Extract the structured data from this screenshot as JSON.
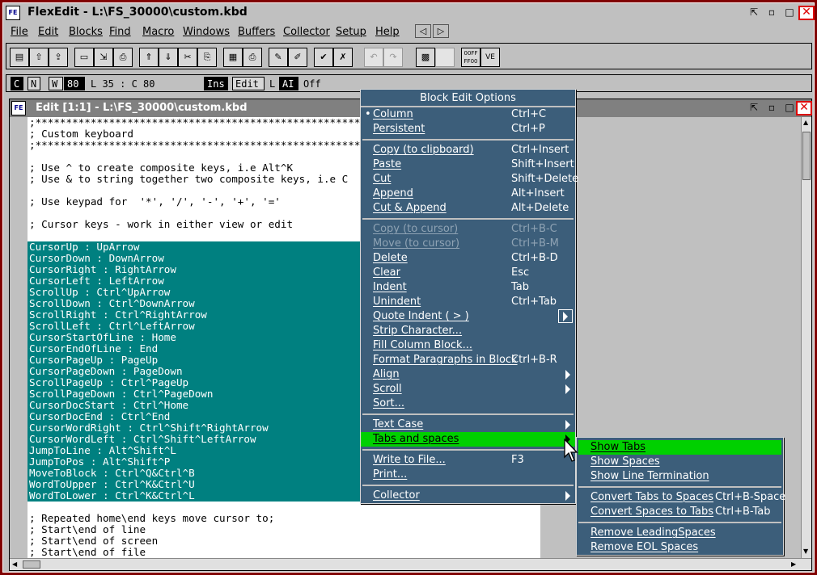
{
  "app": {
    "title": "FlexEdit - L:\\FS_30000\\custom.kbd",
    "icon": "FE"
  },
  "menubar": [
    "File",
    "Edit",
    "Blocks",
    "Find",
    "Macro",
    "Windows",
    "Buffers",
    "Collector",
    "Setup",
    "Help"
  ],
  "toolbar_icons": [
    "record-icon",
    "save-icon",
    "save-all-icon",
    "new-file-icon",
    "open-file-icon",
    "print-file-icon",
    "insert-file-icon",
    "cut-block-icon",
    "cut-icon",
    "paste-icon",
    "doc-icon",
    "printer-icon",
    "find-icon",
    "replace-icon",
    "bookmark-icon",
    "bookmark-jump-icon",
    "undo-icon",
    "redo-icon",
    "grid-icon",
    "blank-icon",
    "hex-icon",
    "ve-icon"
  ],
  "toolbar_text": {
    "hex_top": "00FF",
    "hex_bottom": "FF00",
    "ve": "VE"
  },
  "status": {
    "c": "C",
    "n": "N",
    "w": "W",
    "width": "80",
    "pos": "L     35 : C    80",
    "ins": "Ins",
    "mode": "Edit",
    "l": "L",
    "ai": "AI",
    "off": "Off"
  },
  "edit_window": {
    "title": "Edit [1:1] - L:\\FS_30000\\custom.kbd",
    "lines": [
      ";*********************************************************************",
      "; Custom keyboard",
      ";*********************************************************************",
      "",
      "; Use ^ to create composite keys, i.e Alt^K",
      "; Use & to string together two composite keys, i.e C",
      "",
      "; Use keypad for  '*', '/', '-', '+', '='",
      "",
      "; Cursor keys - work in either view or edit",
      ""
    ],
    "selected_lines": [
      "CursorUp : UpArrow",
      "CursorDown : DownArrow",
      "CursorRight : RightArrow",
      "CursorLeft : LeftArrow",
      "ScrollUp : Ctrl^UpArrow",
      "ScrollDown : Ctrl^DownArrow",
      "ScrollRight : Ctrl^RightArrow",
      "ScrollLeft : Ctrl^LeftArrow",
      "CursorStartOfLine : Home",
      "CursorEndOfLine : End",
      "CursorPageUp : PageUp",
      "CursorPageDown : PageDown",
      "ScrollPageUp : Ctrl^PageUp",
      "ScrollPageDown : Ctrl^PageDown",
      "CursorDocStart : Ctrl^Home",
      "CursorDocEnd : Ctrl^End",
      "CursorWordRight : Ctrl^Shift^RightArrow",
      "CursorWordLeft : Ctrl^Shift^LeftArrow",
      "JumpToLine : Alt^Shift^L",
      "JumpToPos : Alt^Shift^P",
      "MoveToBlock : Ctrl^Q&Ctrl^B",
      "WordToUpper : Ctrl^K&Ctrl^U",
      "WordToLower : Ctrl^K&Ctrl^L"
    ],
    "after_lines": [
      "",
      "; Repeated home\\end keys move cursor to;",
      "; Start\\end of line",
      "; Start\\end of screen",
      "; Start\\end of file"
    ]
  },
  "block_menu": {
    "title": "Block Edit Options",
    "groups": [
      [
        {
          "label": "Column",
          "acc": "Ctrl+C",
          "bullet": true
        },
        {
          "label": "Persistent",
          "acc": "Ctrl+P"
        }
      ],
      [
        {
          "label": "Copy (to clipboard)",
          "acc": "Ctrl+Insert"
        },
        {
          "label": "Paste",
          "acc": "Shift+Insert"
        },
        {
          "label": "Cut",
          "acc": "Shift+Delete"
        },
        {
          "label": "Append",
          "acc": "Alt+Insert"
        },
        {
          "label": "Cut & Append",
          "acc": "Alt+Delete"
        }
      ],
      [
        {
          "label": "Copy (to cursor)",
          "acc": "Ctrl+B-C",
          "disabled": true
        },
        {
          "label": "Move (to cursor)",
          "acc": "Ctrl+B-M",
          "disabled": true
        },
        {
          "label": "Delete",
          "acc": "Ctrl+B-D"
        },
        {
          "label": "Clear",
          "acc": "Esc"
        },
        {
          "label": "Indent",
          "acc": "Tab"
        },
        {
          "label": "Unindent",
          "acc": "Ctrl+Tab"
        },
        {
          "label": "Quote Indent ( > )",
          "acc": "",
          "subbox": true
        },
        {
          "label": "Strip Character...",
          "acc": ""
        },
        {
          "label": "Fill Column Block...",
          "acc": ""
        },
        {
          "label": "Format Paragraphs in Block",
          "acc": "Ctrl+B-R"
        },
        {
          "label": "Align",
          "acc": "",
          "sub": true
        },
        {
          "label": "Scroll",
          "acc": "",
          "sub": true
        },
        {
          "label": "Sort...",
          "acc": ""
        }
      ],
      [
        {
          "label": "Text Case",
          "acc": "",
          "sub": true
        },
        {
          "label": "Tabs and spaces",
          "acc": "",
          "sub": true,
          "hl": true
        }
      ],
      [
        {
          "label": "Write to File...",
          "acc": "F3"
        },
        {
          "label": "Print...",
          "acc": ""
        }
      ],
      [
        {
          "label": "Collector",
          "acc": "",
          "sub": true
        }
      ]
    ]
  },
  "tabs_menu": {
    "groups": [
      [
        {
          "label": "Show Tabs",
          "acc": "",
          "hl": true
        },
        {
          "label": "Show Spaces",
          "acc": ""
        },
        {
          "label": "Show Line Termination",
          "acc": ""
        }
      ],
      [
        {
          "label": "Convert Tabs to Spaces",
          "acc": "Ctrl+B-Space"
        },
        {
          "label": "Convert Spaces to Tabs",
          "acc": "Ctrl+B-Tab"
        }
      ],
      [
        {
          "label": "Remove LeadingSpaces",
          "acc": ""
        },
        {
          "label": "Remove EOL Spaces",
          "acc": ""
        }
      ]
    ]
  },
  "colors": {
    "desktop": "#800000",
    "selection": "#008080",
    "menu_bg": "#3c5e7a",
    "menu_highlight": "#00d000"
  }
}
